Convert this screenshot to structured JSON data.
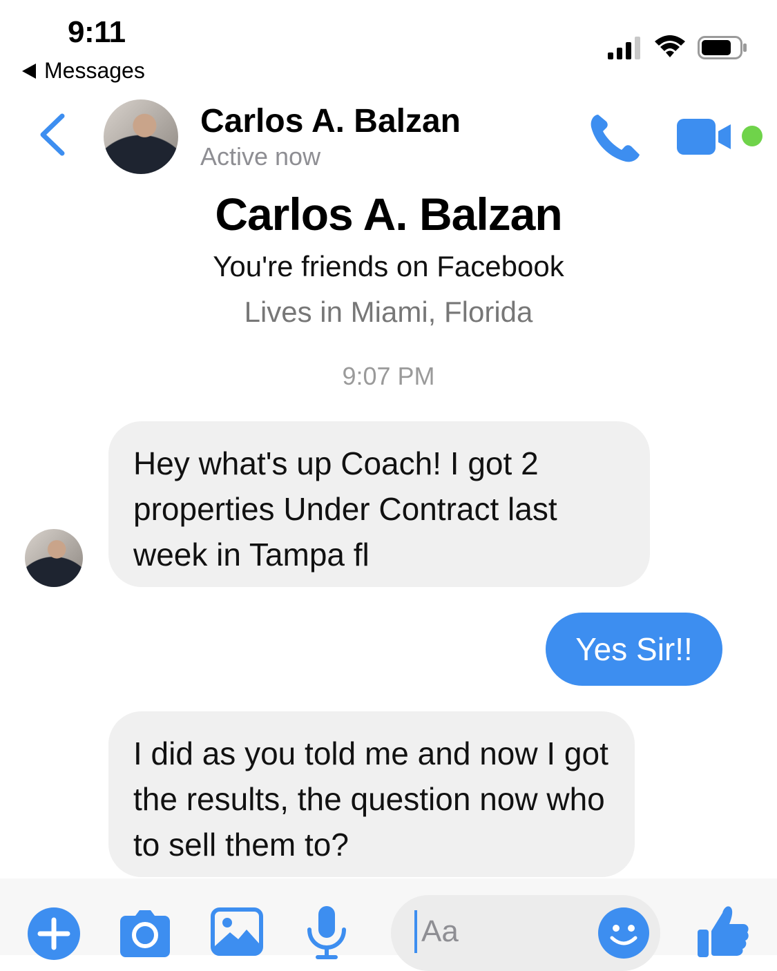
{
  "status_bar": {
    "time": "9:11",
    "back_app_label": "Messages"
  },
  "header": {
    "contact_name": "Carlos A. Balzan",
    "contact_status": "Active now"
  },
  "profile": {
    "name": "Carlos A. Balzan",
    "friends_text": "You're friends on Facebook",
    "location": "Lives in Miami, Florida"
  },
  "conversation": {
    "timestamp": "9:07 PM",
    "messages": [
      {
        "direction": "incoming",
        "text": "Hey what's up Coach! I got 2 properties Under Contract last week in Tampa fl"
      },
      {
        "direction": "outgoing",
        "text": "Yes Sir!!"
      },
      {
        "direction": "incoming",
        "text": "I did as you told me and now I got the results, the question now who to sell them to?"
      }
    ]
  },
  "composer": {
    "placeholder": "Aa",
    "icons": [
      "plus-icon",
      "camera-icon",
      "image-icon",
      "microphone-icon",
      "smiley-icon",
      "thumbs-up-icon"
    ]
  },
  "colors": {
    "accent": "#3d8ef0",
    "incoming_bubble": "#f0f0f0",
    "online": "#6fd34a",
    "muted_text": "#8e8e93"
  }
}
